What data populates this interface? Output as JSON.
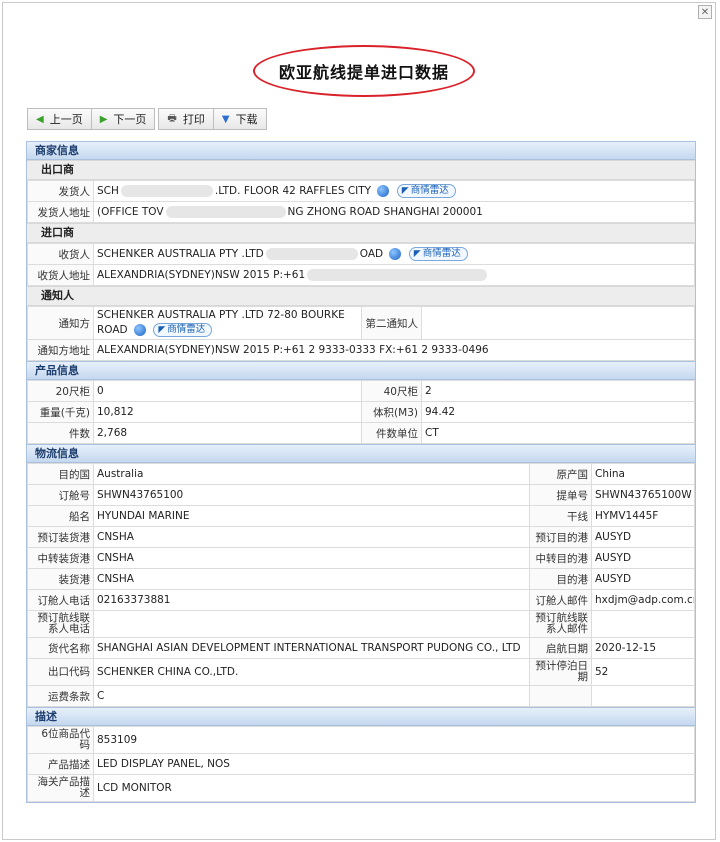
{
  "title": "欧亚航线提单进口数据",
  "toolbar": {
    "prev": "上一页",
    "next": "下一页",
    "print": "打印",
    "download": "下载"
  },
  "badge_label": "商情雷达",
  "merchant": {
    "section": "商家信息",
    "exporter": {
      "heading": "出口商",
      "shipper_label": "发货人",
      "shipper_a": "SCH",
      "shipper_b": ".LTD. FLOOR 42 RAFFLES CITY",
      "address_label": "发货人地址",
      "address_a": "(OFFICE TOV",
      "address_b": "NG ZHONG ROAD SHANGHAI 200001"
    },
    "importer": {
      "heading": "进口商",
      "consignee_label": "收货人",
      "consignee_a": "SCHENKER AUSTRALIA PTY .LTD",
      "consignee_b": "OAD",
      "address_label": "收货人地址",
      "address_a": "ALEXANDRIA(SYDNEY)NSW 2015 P:+61"
    },
    "notify": {
      "heading": "通知人",
      "party_label": "通知方",
      "party": "SCHENKER AUSTRALIA PTY .LTD 72-80 BOURKE ROAD",
      "second_label": "第二通知人",
      "second": "",
      "address_label": "通知方地址",
      "address": "ALEXANDRIA(SYDNEY)NSW 2015 P:+61 2 9333-0333 FX:+61 2 9333-0496"
    }
  },
  "product": {
    "section": "产品信息",
    "rows": [
      {
        "l1": "20尺柜",
        "v1": "0",
        "l2": "40尺柜",
        "v2": "2"
      },
      {
        "l1": "重量(千克)",
        "v1": "10,812",
        "l2": "体积(M3)",
        "v2": "94.42"
      },
      {
        "l1": "件数",
        "v1": "2,768",
        "l2": "件数单位",
        "v2": "CT"
      }
    ]
  },
  "logistics": {
    "section": "物流信息",
    "rows": [
      {
        "l1": "目的国",
        "v1": "Australia",
        "l2": "原产国",
        "v2": "China"
      },
      {
        "l1": "订舱号",
        "v1": "SHWN43765100",
        "l2": "提单号",
        "v2": "SHWN43765100W"
      },
      {
        "l1": "船名",
        "v1": "HYUNDAI MARINE",
        "l2": "干线",
        "v2": "HYMV1445F"
      },
      {
        "l1": "预订装货港",
        "v1": "CNSHA",
        "l2": "预订目的港",
        "v2": "AUSYD"
      },
      {
        "l1": "中转装货港",
        "v1": "CNSHA",
        "l2": "中转目的港",
        "v2": "AUSYD"
      },
      {
        "l1": "装货港",
        "v1": "CNSHA",
        "l2": "目的港",
        "v2": "AUSYD"
      },
      {
        "l1": "订舱人电话",
        "v1": "02163373881",
        "l2": "订舱人邮件",
        "v2": "hxdjm@adp.com.cn"
      },
      {
        "l1": "预订航线联系人电话",
        "v1": "",
        "l2": "预订航线联系人邮件",
        "v2": ""
      },
      {
        "l1": "货代名称",
        "v1": "SHANGHAI ASIAN DEVELOPMENT INTERNATIONAL TRANSPORT PUDONG CO., LTD",
        "l2": "启航日期",
        "v2": "2020-12-15"
      },
      {
        "l1": "出口代码",
        "v1": "SCHENKER CHINA CO.,LTD.",
        "l2": "预计停泊日期",
        "v2": "52"
      },
      {
        "l1": "运费条款",
        "v1": "C",
        "l2": "",
        "v2": ""
      }
    ]
  },
  "description": {
    "section": "描述",
    "rows": [
      {
        "l": "6位商品代码",
        "v": "853109"
      },
      {
        "l": "产品描述",
        "v": "LED DISPLAY PANEL, NOS"
      },
      {
        "l": "海关产品描述",
        "v": "LCD MONITOR"
      }
    ]
  }
}
